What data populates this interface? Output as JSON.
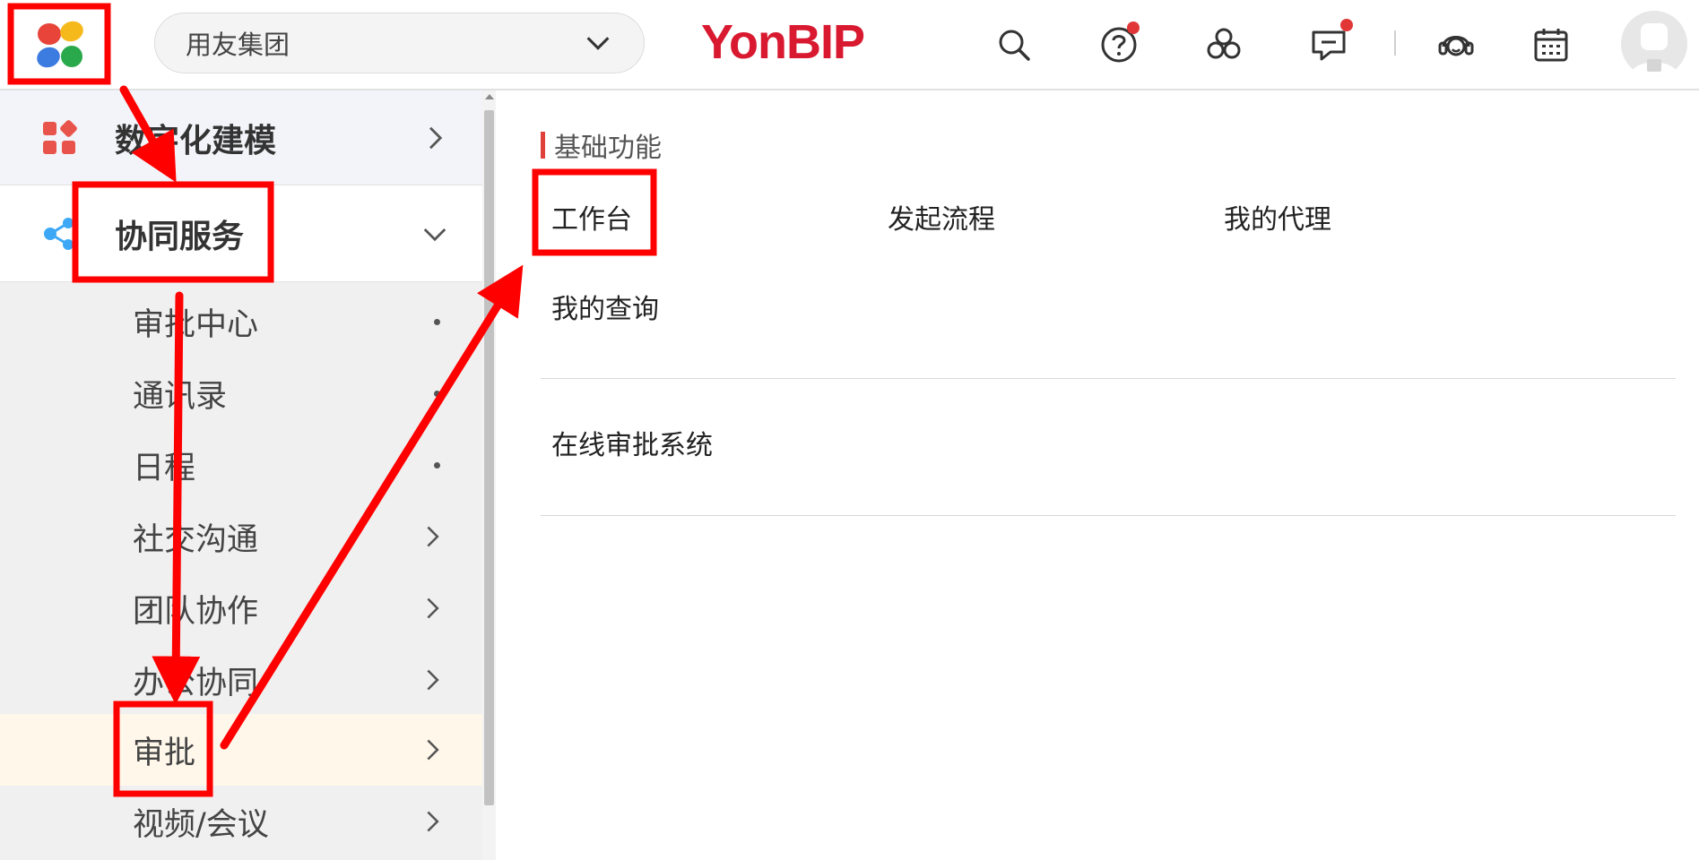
{
  "header": {
    "org_select_value": "用友集团",
    "logo_text": "YonBIP",
    "icons": [
      "app-launcher-icon",
      "chevron-down-icon",
      "search-icon",
      "help-icon",
      "apps-cluster-icon",
      "message-icon",
      "customer-service-icon",
      "calendar-icon",
      "avatar-icon"
    ]
  },
  "sidebar": {
    "groups": [
      {
        "label": "数字化建模",
        "icon": "modeling-icon",
        "state": "collapsed"
      },
      {
        "label": "协同服务",
        "icon": "share-icon",
        "state": "expanded"
      }
    ],
    "items": [
      {
        "label": "审批中心",
        "indicator": "dot"
      },
      {
        "label": "通讯录",
        "indicator": "dot"
      },
      {
        "label": "日程",
        "indicator": "dot"
      },
      {
        "label": "社交沟通",
        "indicator": "chevron"
      },
      {
        "label": "团队协作",
        "indicator": "chevron"
      },
      {
        "label": "办公协同",
        "indicator": "chevron"
      },
      {
        "label": "审批",
        "indicator": "chevron",
        "active": true
      },
      {
        "label": "视频/会议",
        "indicator": "chevron"
      }
    ]
  },
  "main": {
    "section_title": "基础功能",
    "functions": [
      "工作台",
      "发起流程",
      "我的代理",
      "我的查询"
    ],
    "system_link": "在线审批系统"
  },
  "colors": {
    "brand_red": "#d8192f",
    "annotation_red": "#ff0000",
    "active_item_bg": "#fff7ea",
    "section_accent": "#e0403a"
  }
}
